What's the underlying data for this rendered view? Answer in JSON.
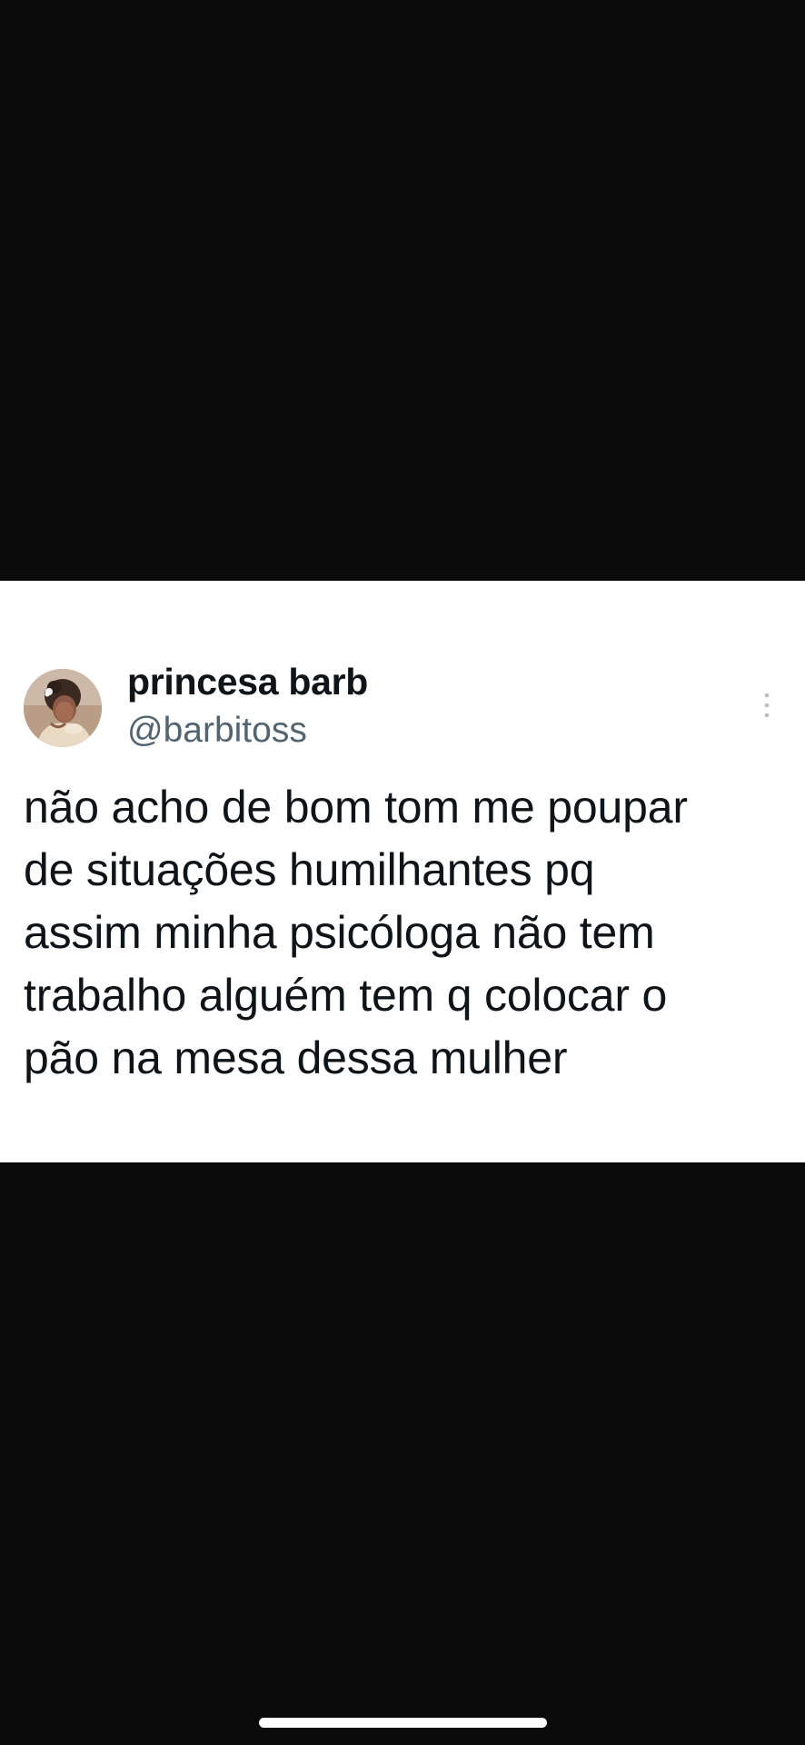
{
  "tweet": {
    "display_name": "princesa barb",
    "handle": "@barbitoss",
    "avatar_icon": "profile-photo",
    "more_icon": "more-vertical-icon",
    "text": "não acho de bom tom me poupar\nde situações humilhantes pq\nassim minha psicóloga não tem\ntrabalho alguém tem q colocar o\npão na mesa dessa mulher"
  },
  "colors": {
    "background": "#0b0b0c",
    "card": "#ffffff",
    "primary_text": "#0f1419",
    "secondary_text": "#536471",
    "home_indicator": "#ffffff"
  }
}
